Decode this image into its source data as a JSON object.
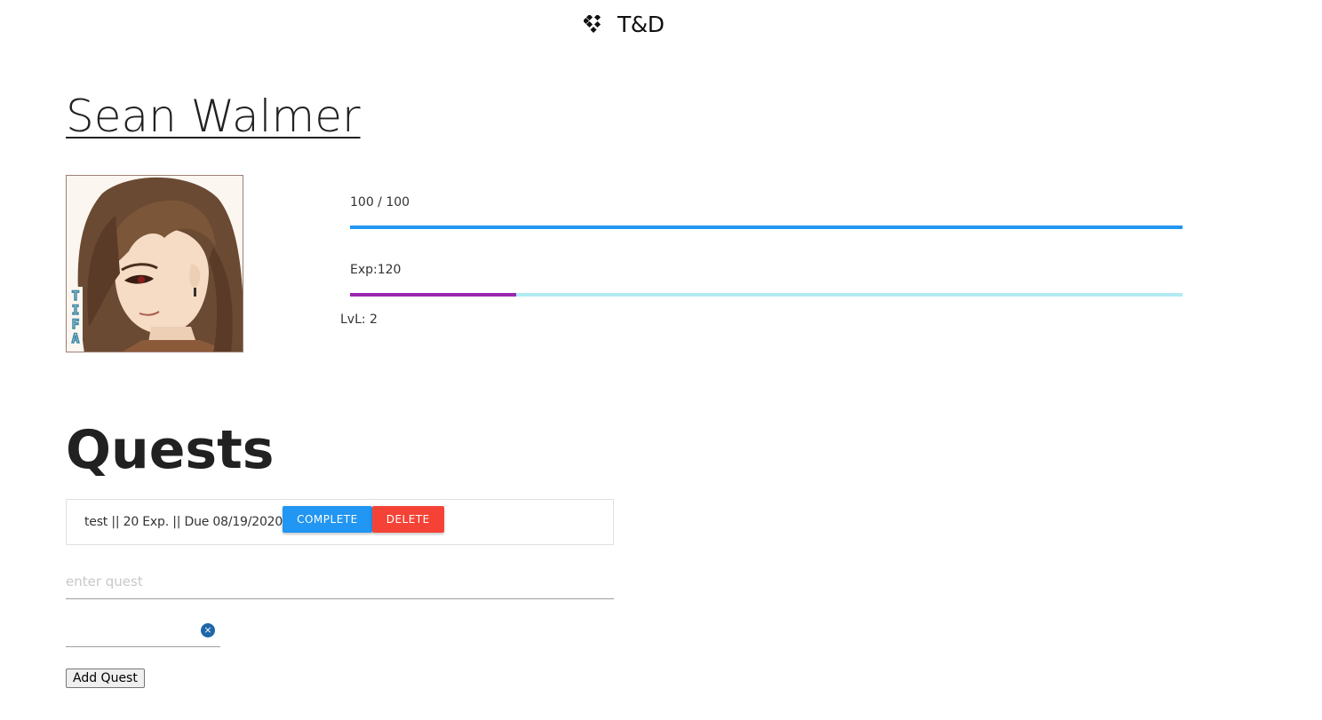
{
  "header": {
    "brand_icon": "gamepad-icon",
    "title": "T&D"
  },
  "profile": {
    "name": "Sean Walmer",
    "avatar_icon": "character-portrait",
    "hp": {
      "label": "100 / 100",
      "current": 100,
      "max": 100,
      "fill_percent": 100,
      "color": "#2196f3",
      "track_color": "#bbdefb"
    },
    "exp": {
      "label": "Exp:120",
      "fill_percent": 20,
      "color": "#9c27b0",
      "track_color": "#b2ebf2"
    },
    "level_label": "LvL: 2"
  },
  "quests": {
    "title": "Quests",
    "items": [
      {
        "text": "test || 20 Exp. || Due 08/19/2020",
        "complete_label": "COMPLETE",
        "delete_label": "DELETE"
      }
    ],
    "form": {
      "quest_placeholder": "enter quest",
      "quest_value": "",
      "date_value": "",
      "clear_glyph": "×",
      "add_label": "Add Quest"
    }
  },
  "colors": {
    "complete": "#2196f3",
    "delete": "#f44336",
    "date_clear": "#1f66a9"
  }
}
